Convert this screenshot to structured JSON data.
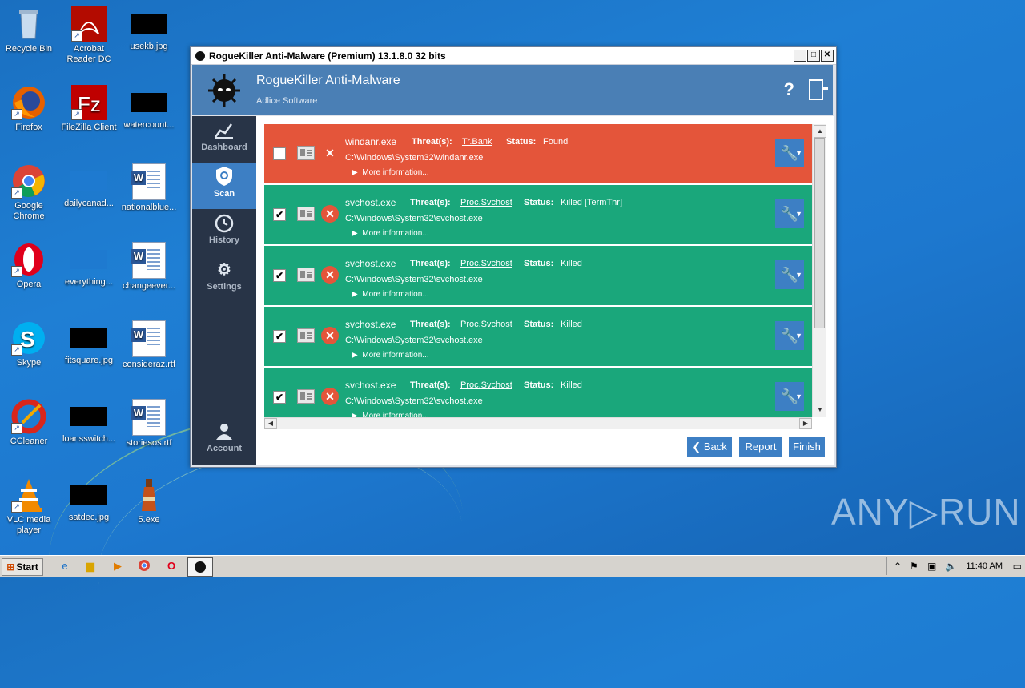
{
  "desktop": {
    "icons": [
      {
        "label": "Recycle Bin"
      },
      {
        "label": "Acrobat Reader DC"
      },
      {
        "label": "usekb.jpg"
      },
      {
        "label": "Firefox"
      },
      {
        "label": "FileZilla Client"
      },
      {
        "label": "watercount..."
      },
      {
        "label": "Google Chrome"
      },
      {
        "label": "dailycanad..."
      },
      {
        "label": "nationalblue..."
      },
      {
        "label": "Opera"
      },
      {
        "label": "everything..."
      },
      {
        "label": "changeever..."
      },
      {
        "label": "Skype"
      },
      {
        "label": "fitsquare.jpg"
      },
      {
        "label": "consideraz.rtf"
      },
      {
        "label": "CCleaner"
      },
      {
        "label": "loansswitch..."
      },
      {
        "label": "storiesos.rtf"
      },
      {
        "label": "VLC media player"
      },
      {
        "label": "satdec.jpg"
      },
      {
        "label": "5.exe"
      }
    ]
  },
  "window": {
    "title": "RogueKiller Anti-Malware (Premium) 13.1.8.0 32 bits",
    "min": "_",
    "max": "□",
    "close": "✕"
  },
  "header": {
    "title": "RogueKiller Anti-Malware",
    "subtitle": "Adlice Software",
    "help": "?"
  },
  "sidebar": {
    "items": [
      {
        "label": "Dashboard",
        "icon": "chart-icon",
        "glyph": "📈"
      },
      {
        "label": "Scan",
        "icon": "shield-icon",
        "glyph": "⛨"
      },
      {
        "label": "History",
        "icon": "clock-icon",
        "glyph": "◷"
      },
      {
        "label": "Settings",
        "icon": "gear-icon",
        "glyph": "⚙"
      }
    ],
    "account": {
      "label": "Account",
      "glyph": "👤"
    }
  },
  "results": {
    "threat_label": "Threat(s):",
    "status_label": "Status:",
    "more_info": "More information...",
    "rows": [
      {
        "name": "windanr.exe",
        "threat": "Tr.Bank",
        "status": "Found",
        "path": "C:\\Windows\\System32\\windanr.exe",
        "checked": "",
        "state": "found"
      },
      {
        "name": "svchost.exe",
        "threat": "Proc.Svchost",
        "status": "Killed [TermThr]",
        "path": "C:\\Windows\\System32\\svchost.exe",
        "checked": "✔",
        "state": "killed"
      },
      {
        "name": "svchost.exe",
        "threat": "Proc.Svchost",
        "status": "Killed",
        "path": "C:\\Windows\\System32\\svchost.exe",
        "checked": "✔",
        "state": "killed"
      },
      {
        "name": "svchost.exe",
        "threat": "Proc.Svchost",
        "status": "Killed",
        "path": "C:\\Windows\\System32\\svchost.exe",
        "checked": "✔",
        "state": "killed"
      },
      {
        "name": "svchost.exe",
        "threat": "Proc.Svchost",
        "status": "Killed",
        "path": "C:\\Windows\\System32\\svchost.exe",
        "checked": "✔",
        "state": "killed"
      }
    ]
  },
  "footer": {
    "back": "Back",
    "report": "Report",
    "finish": "Finish"
  },
  "taskbar": {
    "start": "Start",
    "clock": "11:40 AM"
  },
  "watermark": "ANY▷RUN",
  "colors": {
    "found": "#e4553a",
    "killed": "#1aa77b",
    "accent": "#3d7fc4",
    "sidebar": "#283447",
    "header": "#4a7fb5"
  }
}
